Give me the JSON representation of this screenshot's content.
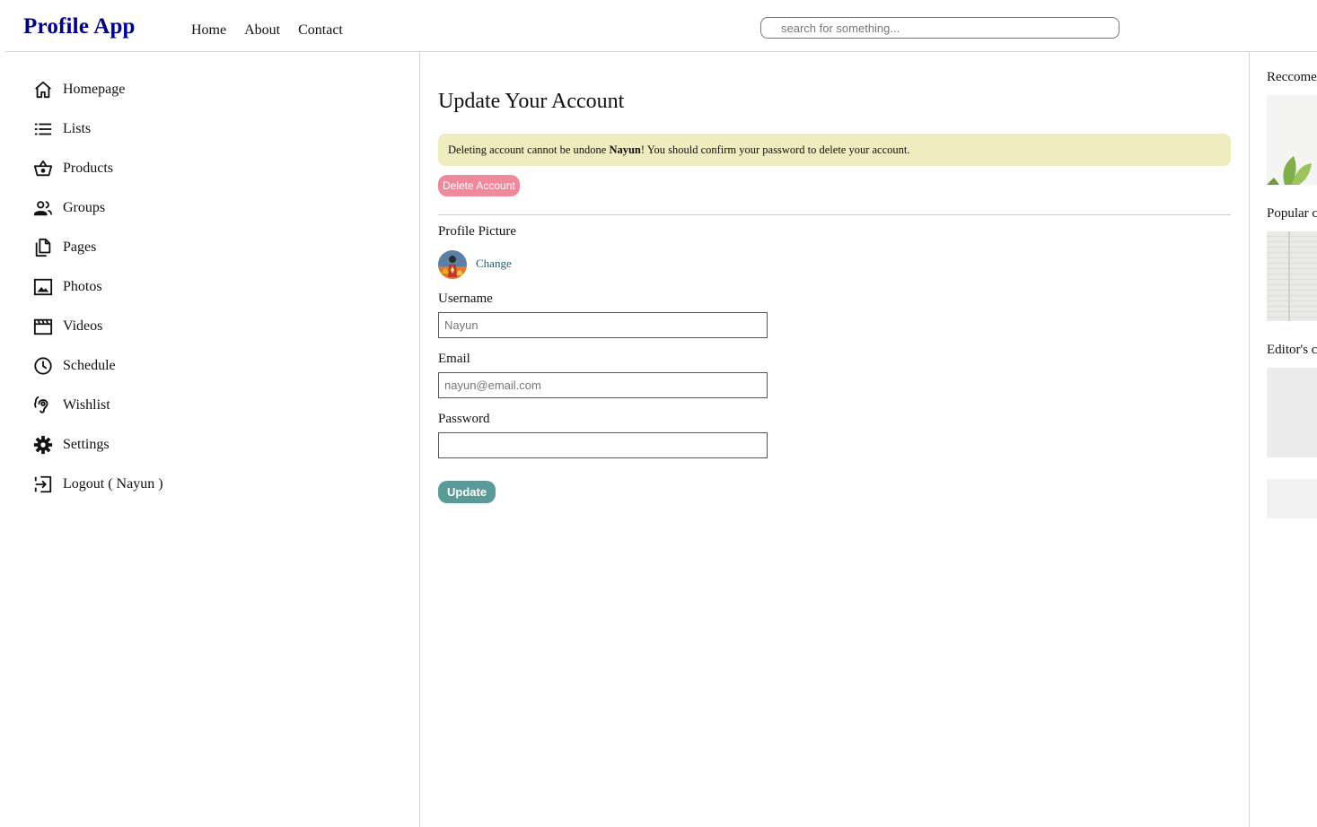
{
  "header": {
    "brand": "Profile App",
    "nav": [
      "Home",
      "About",
      "Contact"
    ],
    "search_placeholder": "search for something..."
  },
  "sidebar": {
    "items": [
      {
        "label": "Homepage",
        "icon": "home-icon"
      },
      {
        "label": "Lists",
        "icon": "list-icon"
      },
      {
        "label": "Products",
        "icon": "basket-icon"
      },
      {
        "label": "Groups",
        "icon": "group-icon"
      },
      {
        "label": "Pages",
        "icon": "pages-icon"
      },
      {
        "label": "Photos",
        "icon": "photo-icon"
      },
      {
        "label": "Videos",
        "icon": "video-icon"
      },
      {
        "label": "Schedule",
        "icon": "clock-icon"
      },
      {
        "label": "Wishlist",
        "icon": "wishlist-icon"
      },
      {
        "label": "Settings",
        "icon": "gear-icon"
      },
      {
        "label": "Logout ( Nayun )",
        "icon": "logout-icon"
      }
    ]
  },
  "main": {
    "title": "Update Your Account",
    "alert": {
      "prefix": "Deleting account cannot be undone ",
      "name": "Nayun",
      "suffix": "! You should confirm your password to delete your account."
    },
    "delete_button": "Delete Account",
    "profile_picture_label": "Profile Picture",
    "change_link": "Change",
    "username_label": "Username",
    "username_placeholder": "Nayun",
    "email_label": "Email",
    "email_placeholder": "nayun@email.com",
    "password_label": "Password",
    "password_value": "",
    "update_button": "Update"
  },
  "right": {
    "sections": [
      "Reccome",
      "Popular c",
      "Editor's c"
    ]
  },
  "colors": {
    "brand": "#000080",
    "alert_bg": "#efedbf",
    "delete_btn": "#ef8a9d",
    "update_btn": "#5a9a98",
    "link": "#1d5c6b"
  }
}
